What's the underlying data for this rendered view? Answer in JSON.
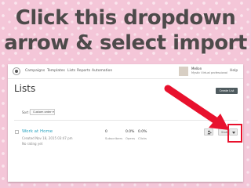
{
  "headline": {
    "line1": "Click this dropdown",
    "line2": "arrow & select import"
  },
  "nav": {
    "items": [
      "Campaigns",
      "Templates",
      "Lists",
      "Reports",
      "Automation"
    ]
  },
  "account": {
    "name": "Mellon",
    "subtitle": "Mystic Virtual professional",
    "help": "Help"
  },
  "page": {
    "title": "Lists",
    "create_button": "Create List",
    "sort_label": "Sort By",
    "sort_value": "Custom order"
  },
  "list_row": {
    "name": "Work at Home",
    "created": "Created Nov 18, 2015 03:47 pm",
    "rating": "No rating yet",
    "stats": [
      {
        "value": "0",
        "label": "Subscribers"
      },
      {
        "value": "0.0%",
        "label": "Opens"
      },
      {
        "value": "0.0%",
        "label": "Clicks"
      }
    ],
    "stats_button": "Stats"
  },
  "colors": {
    "accent_link": "#2aa4c0",
    "highlight_red": "#e8112d",
    "button_dark": "#4f5b5f"
  }
}
